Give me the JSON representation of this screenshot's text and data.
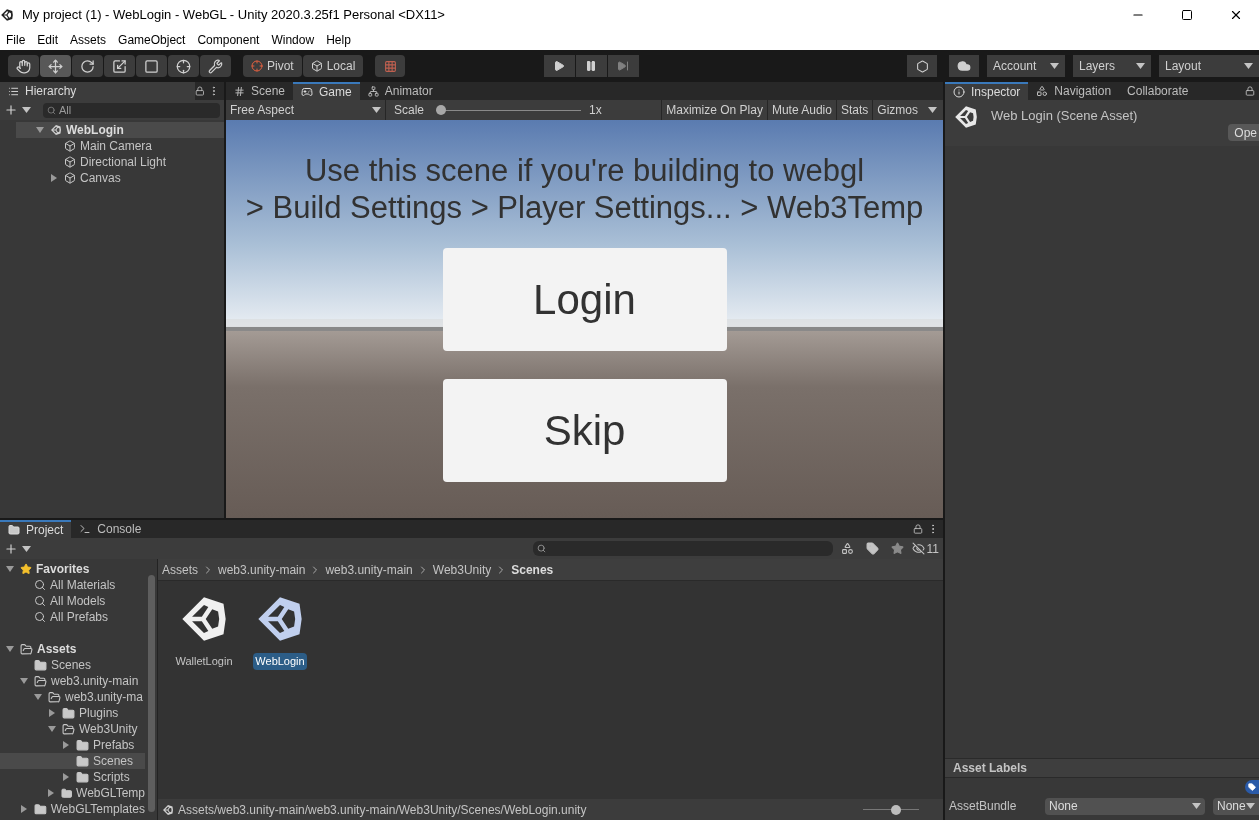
{
  "window": {
    "title": "My project (1) - WebLogin - WebGL - Unity 2020.3.25f1 Personal <DX11>"
  },
  "menu": [
    "File",
    "Edit",
    "Assets",
    "GameObject",
    "Component",
    "Window",
    "Help"
  ],
  "toolbar": {
    "tools": [
      {
        "kind": "hand",
        "selected": false
      },
      {
        "kind": "move",
        "selected": true
      },
      {
        "kind": "rotate",
        "selected": false
      },
      {
        "kind": "scale",
        "selected": false
      },
      {
        "kind": "rect",
        "selected": false
      },
      {
        "kind": "transform",
        "selected": false
      },
      {
        "kind": "custom",
        "selected": false
      }
    ],
    "pivot": "Pivot",
    "local": "Local",
    "account": "Account",
    "layers": "Layers",
    "layout": "Layout"
  },
  "hierarchy": {
    "tab": "Hierarchy",
    "search_placeholder": "All",
    "tree": [
      {
        "label": "WebLogin",
        "kind": "scene",
        "expanded": true,
        "selected": true,
        "children": [
          {
            "label": "Main Camera",
            "kind": "object",
            "selected": false
          },
          {
            "label": "Directional Light",
            "kind": "object",
            "selected": false
          },
          {
            "label": "Canvas",
            "kind": "object",
            "expanded": false,
            "selected": false
          }
        ]
      }
    ]
  },
  "view": {
    "tabs": [
      {
        "label": "Scene",
        "kind": "scene",
        "selected": false
      },
      {
        "label": "Game",
        "kind": "game",
        "selected": true
      },
      {
        "label": "Animator",
        "kind": "animator",
        "selected": false
      }
    ],
    "aspect": "Free Aspect",
    "scale_label": "Scale",
    "scale": {
      "level": 0,
      "reading": "1x"
    },
    "buttons": [
      "Maximize On Play",
      "Mute Audio",
      "Stats",
      "Gizmos"
    ],
    "game": {
      "lines": [
        "Use this scene if you're building to webgl",
        "> Build Settings > Player Settings... > Web3Temp"
      ],
      "buttons": [
        "Login",
        "Skip"
      ]
    }
  },
  "inspector": {
    "tabs": [
      {
        "label": "Inspector",
        "kind": "info",
        "selected": true
      },
      {
        "label": "Navigation",
        "kind": "navigation",
        "selected": false
      },
      {
        "label": "Collaborate",
        "kind": "plain",
        "selected": false
      }
    ],
    "title": "Web Login (Scene Asset)",
    "open_button": "Ope",
    "asset_labels": "Asset Labels",
    "asset_bundle": "AssetBundle",
    "bundle_values": [
      "None",
      "None"
    ]
  },
  "project": {
    "tabs": [
      {
        "label": "Project",
        "kind": "folder",
        "selected": true
      },
      {
        "label": "Console",
        "kind": "console",
        "selected": false
      }
    ],
    "hidden_count": "11",
    "tree": [
      {
        "label": "Favorites",
        "kind": "favorites",
        "expanded": true,
        "selected": false,
        "children": [
          {
            "label": "All Materials",
            "kind": "search",
            "selected": false
          },
          {
            "label": "All Models",
            "kind": "search",
            "selected": false
          },
          {
            "label": "All Prefabs",
            "kind": "search",
            "selected": false
          }
        ]
      },
      {
        "label": "Assets",
        "kind": "folder",
        "expanded": true,
        "selected": false,
        "children": [
          {
            "label": "Scenes",
            "kind": "folder",
            "selected": false
          },
          {
            "label": "web3.unity-main",
            "kind": "folder",
            "expanded": true,
            "selected": false,
            "children": [
              {
                "label": "web3.unity-ma",
                "kind": "folder",
                "expanded": true,
                "selected": false,
                "children": [
                  {
                    "label": "Plugins",
                    "kind": "folder",
                    "expanded": false,
                    "selected": false
                  },
                  {
                    "label": "Web3Unity",
                    "kind": "folder",
                    "expanded": true,
                    "selected": false,
                    "children": [
                      {
                        "label": "Prefabs",
                        "kind": "folder",
                        "expanded": false,
                        "selected": false
                      },
                      {
                        "label": "Scenes",
                        "kind": "folder",
                        "selected": true
                      },
                      {
                        "label": "Scripts",
                        "kind": "folder",
                        "expanded": false,
                        "selected": false
                      }
                    ]
                  },
                  {
                    "label": "WebGLTemp",
                    "kind": "folder",
                    "expanded": false,
                    "selected": false
                  }
                ]
              }
            ]
          },
          {
            "label": "WebGLTemplates",
            "kind": "folder",
            "expanded": false,
            "selected": false
          }
        ]
      }
    ],
    "breadcrumb": [
      "Assets",
      "web3.unity-main",
      "web3.unity-main",
      "Web3Unity",
      "Scenes"
    ],
    "items": [
      {
        "label": "WalletLogin",
        "selected": false
      },
      {
        "label": "WebLogin",
        "selected": true
      }
    ],
    "path": "Assets/web3.unity-main/web3.unity-main/Web3Unity/Scenes/WebLogin.unity",
    "zoom": {
      "level": 0.6
    }
  }
}
